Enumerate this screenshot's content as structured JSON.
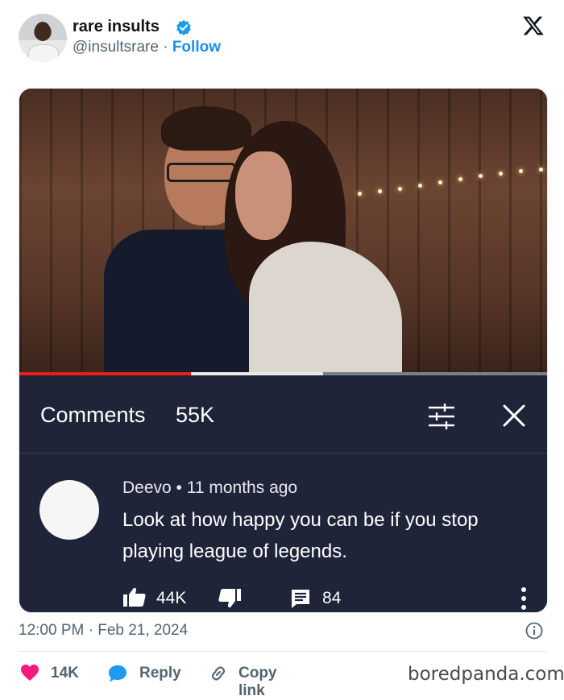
{
  "author": {
    "display_name": "rare insults",
    "handle": "@insultsrare",
    "separator": " · ",
    "follow_label": "Follow",
    "verified_icon": "verified-badge-icon"
  },
  "brand": {
    "icon": "x-logo-icon"
  },
  "embedded_video": {
    "progress": {
      "played_fraction": 0.325,
      "buffered_fraction": 0.575
    },
    "colors": {
      "played": "#e62117",
      "panel": "#1f2439"
    },
    "comments_header": {
      "title": "Comments",
      "count": "55K",
      "icons": [
        "filter-icon",
        "close-icon"
      ]
    },
    "comment": {
      "author": "Deevo",
      "time": "11 months ago",
      "separator": " • ",
      "text": "Look at how happy you can be if you stop playing league of legends.",
      "likes": "44K",
      "replies": "84"
    }
  },
  "tweet_meta": {
    "timestamp": "12:00 PM · Feb 21, 2024"
  },
  "actions": {
    "likes": "14K",
    "reply_label": "Reply",
    "copy_link_label": "Copy link",
    "accent_color": "#f91880"
  },
  "watermark": "boredpanda.com"
}
